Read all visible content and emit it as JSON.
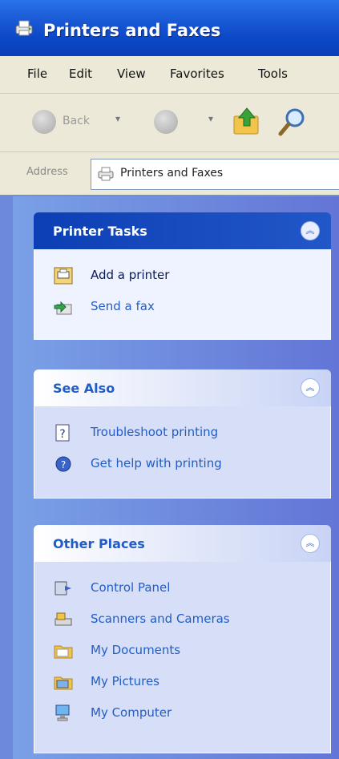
{
  "window": {
    "title": "Printers and Faxes"
  },
  "menubar": {
    "items": [
      "File",
      "Edit",
      "View",
      "Favorites",
      "Tools"
    ]
  },
  "toolbar": {
    "back_label": "Back"
  },
  "address": {
    "label": "Address",
    "value": "Printers and Faxes"
  },
  "groups": {
    "printer_tasks": {
      "title": "Printer Tasks",
      "items": [
        "Add a printer",
        "Send a fax"
      ]
    },
    "see_also": {
      "title": "See Also",
      "items": [
        "Troubleshoot printing",
        "Get help with printing"
      ]
    },
    "other_places": {
      "title": "Other Places",
      "items": [
        "Control Panel",
        "Scanners and Cameras",
        "My Documents",
        "My Pictures",
        "My Computer"
      ]
    }
  },
  "icons": {
    "title": "printers-faxes-icon",
    "address": "printers-faxes-icon",
    "add_printer": "add-printer-icon",
    "send_fax": "send-fax-icon",
    "troubleshoot": "troubleshoot-icon",
    "help": "help-icon",
    "control_panel": "control-panel-icon",
    "scanners": "scanners-cameras-icon",
    "my_documents": "folder-icon",
    "my_pictures": "folder-icon",
    "my_computer": "my-computer-icon"
  },
  "colors": {
    "titlebar": "#0b47c6",
    "pane": "#6f8fd8",
    "link": "#215dc6"
  }
}
